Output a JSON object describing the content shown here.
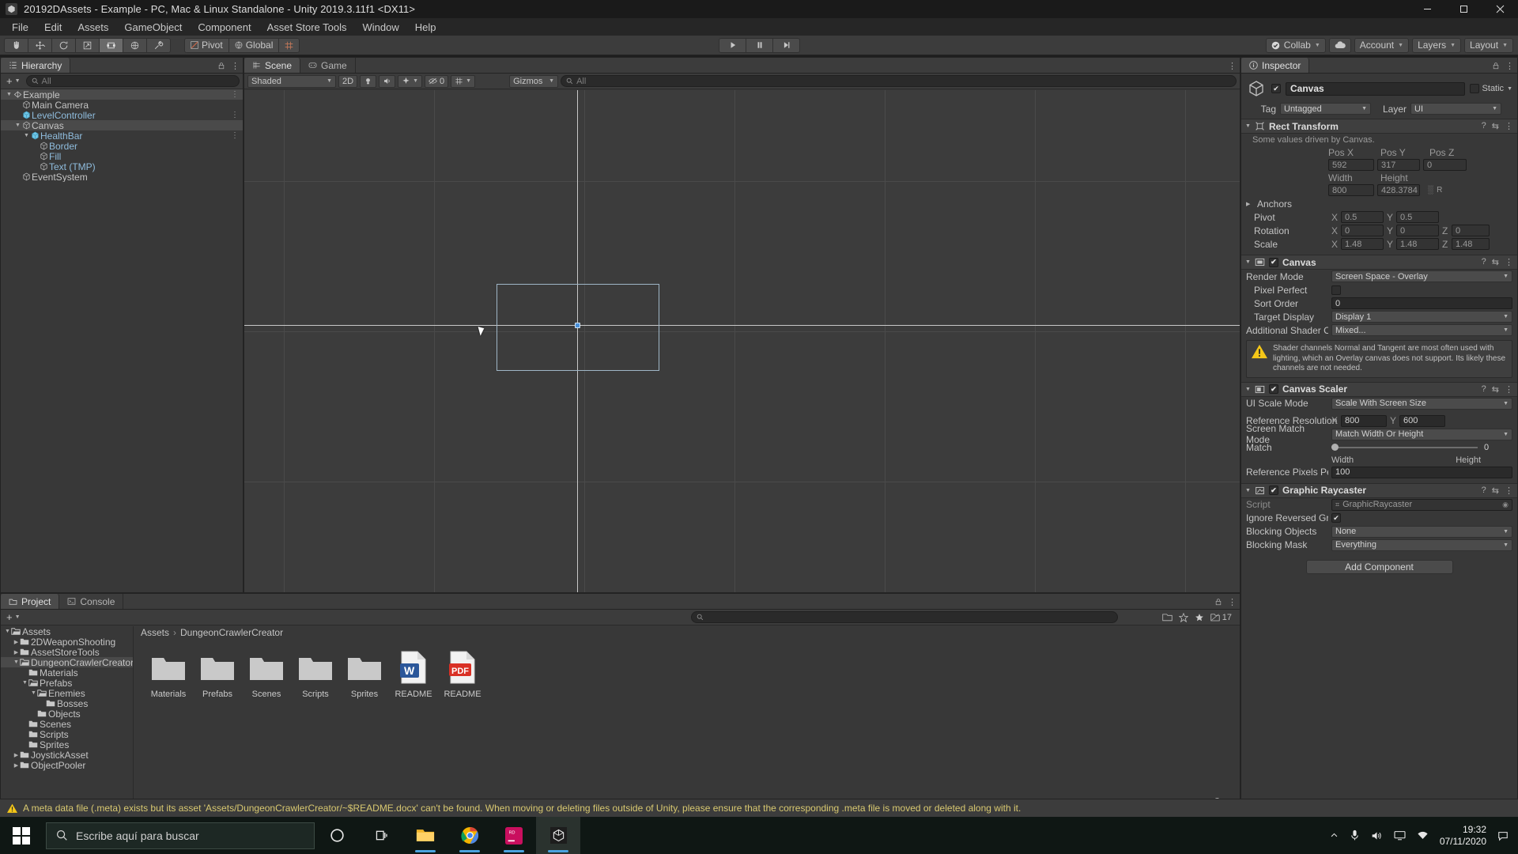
{
  "window": {
    "title": "20192DAssets - Example - PC, Mac & Linux Standalone - Unity 2019.3.11f1 <DX11>",
    "minimize": "–",
    "maximize": "☐",
    "close": "✕",
    "app_icon": "unity-icon"
  },
  "menubar": [
    "File",
    "Edit",
    "Assets",
    "GameObject",
    "Component",
    "Asset Store Tools",
    "Window",
    "Help"
  ],
  "toolbar": {
    "tools": [
      {
        "name": "hand-tool",
        "glyph": "✋",
        "selected": false
      },
      {
        "name": "move-tool",
        "glyph": "✥",
        "selected": false
      },
      {
        "name": "rotate-tool",
        "glyph": "↺",
        "selected": false
      },
      {
        "name": "scale-tool",
        "glyph": "↗",
        "selected": false
      },
      {
        "name": "rect-tool",
        "glyph": "⬚",
        "selected": true
      },
      {
        "name": "transform-tool",
        "glyph": "♁",
        "selected": false
      },
      {
        "name": "custom-tool",
        "glyph": "⚒",
        "selected": false
      }
    ],
    "pivot_label": "Pivot",
    "global_label": "Global",
    "grid_label": "grid-snap-icon",
    "play": "▶",
    "pause": "⏸",
    "step": "⏭",
    "collab_label": "Collab",
    "cloud_label": "cloud-icon",
    "account_label": "Account",
    "layers_label": "Layers",
    "layout_label": "Layout"
  },
  "hierarchy": {
    "tab_label": "Hierarchy",
    "create_label": "+",
    "search_placeholder": "All",
    "items": [
      {
        "label": "Example",
        "depth": 0,
        "icon": "scene-icon",
        "expanded": true,
        "selected": true,
        "prefab": false,
        "menu": true
      },
      {
        "label": "Main Camera",
        "depth": 1,
        "icon": "gameobject-icon",
        "expanded": null,
        "selected": false,
        "prefab": false
      },
      {
        "label": "LevelController",
        "depth": 1,
        "icon": "prefab-icon",
        "expanded": null,
        "selected": false,
        "prefab": true,
        "menu": true
      },
      {
        "label": "Canvas",
        "depth": 1,
        "icon": "gameobject-icon",
        "expanded": true,
        "selected": true,
        "prefab": false
      },
      {
        "label": "HealthBar",
        "depth": 2,
        "icon": "prefab-icon",
        "expanded": true,
        "selected": false,
        "prefab": true,
        "menu": true
      },
      {
        "label": "Border",
        "depth": 3,
        "icon": "gameobject-icon",
        "expanded": null,
        "selected": false,
        "prefab": true
      },
      {
        "label": "Fill",
        "depth": 3,
        "icon": "gameobject-icon",
        "expanded": null,
        "selected": false,
        "prefab": true
      },
      {
        "label": "Text (TMP)",
        "depth": 3,
        "icon": "gameobject-icon",
        "expanded": null,
        "selected": false,
        "prefab": true
      },
      {
        "label": "EventSystem",
        "depth": 1,
        "icon": "gameobject-icon",
        "expanded": null,
        "selected": false,
        "prefab": false
      }
    ]
  },
  "scene": {
    "tab_scene": "Scene",
    "tab_game": "Game",
    "shading_mode": "Shaded",
    "mode_2d": "2D",
    "lighting_icon": "lighting-icon",
    "audio_icon": "audio-icon",
    "fx_icon": "effects-icon",
    "hidden_count": "0",
    "grid_icon": "scene-grid-icon",
    "gizmos_label": "Gizmos",
    "search_placeholder": "All"
  },
  "inspector": {
    "tab_label": "Inspector",
    "object_name": "Canvas",
    "enabled": true,
    "static_label": "Static",
    "tag_label": "Tag",
    "tag_value": "Untagged",
    "layer_label": "Layer",
    "layer_value": "UI",
    "components": [
      {
        "title": "Rect Transform",
        "icon": "rect-transform-icon",
        "has_checkbox": false,
        "note": "Some values driven by Canvas.",
        "fields": {
          "pos_x_label": "Pos X",
          "pos_x": "592",
          "pos_y_label": "Pos Y",
          "pos_y": "317",
          "pos_z_label": "Pos Z",
          "pos_z": "0",
          "width_label": "Width",
          "width": "800",
          "height_label": "Height",
          "height": "428.3784",
          "anchors_label": "Anchors",
          "pivot_label": "Pivot",
          "pivot_x": "0.5",
          "pivot_y": "0.5",
          "rotation_label": "Rotation",
          "rot_x": "0",
          "rot_y": "0",
          "rot_z": "0",
          "scale_label": "Scale",
          "scale_x": "1.48",
          "scale_y": "1.48",
          "scale_z": "1.48"
        }
      },
      {
        "title": "Canvas",
        "icon": "canvas-icon",
        "has_checkbox": true,
        "rows": [
          {
            "label": "Render Mode",
            "type": "dropdown",
            "value": "Screen Space - Overlay"
          },
          {
            "label": "Pixel Perfect",
            "type": "checkbox",
            "value": false
          },
          {
            "label": "Sort Order",
            "type": "text",
            "value": "0"
          },
          {
            "label": "Target Display",
            "type": "dropdown",
            "value": "Display 1"
          },
          {
            "label": "Additional Shader Cha",
            "type": "dropdown",
            "value": "Mixed..."
          }
        ],
        "warning": "Shader channels Normal and Tangent are most often used with lighting, which an Overlay canvas does not support. Its likely these channels are not needed."
      },
      {
        "title": "Canvas Scaler",
        "icon": "canvas-scaler-icon",
        "has_checkbox": true,
        "rows": [
          {
            "label": "UI Scale Mode",
            "type": "dropdown",
            "value": "Scale With Screen Size"
          },
          {
            "label": "Reference Resolution",
            "type": "xy",
            "x": "800",
            "y": "600"
          },
          {
            "label": "Screen Match Mode",
            "type": "dropdown",
            "value": "Match Width Or Height"
          },
          {
            "label": "Match",
            "type": "slider",
            "value": "0",
            "left": "Width",
            "right": "Height"
          },
          {
            "label": "Reference Pixels Per I",
            "type": "text",
            "value": "100"
          }
        ]
      },
      {
        "title": "Graphic Raycaster",
        "icon": "graphic-raycaster-icon",
        "has_checkbox": true,
        "rows": [
          {
            "label": "Script",
            "type": "object",
            "value": "GraphicRaycaster"
          },
          {
            "label": "Ignore Reversed Grap",
            "type": "checkbox",
            "value": true
          },
          {
            "label": "Blocking Objects",
            "type": "dropdown",
            "value": "None"
          },
          {
            "label": "Blocking Mask",
            "type": "dropdown",
            "value": "Everything"
          }
        ]
      }
    ],
    "add_component_label": "Add Component"
  },
  "project": {
    "tab_project": "Project",
    "tab_console": "Console",
    "create_label": "+",
    "search_placeholder": "",
    "asset_count": "17",
    "breadcrumb": [
      "Assets",
      "DungeonCrawlerCreator"
    ],
    "tree": [
      {
        "label": "Assets",
        "depth": 0,
        "expanded": true,
        "selected": false,
        "open": true
      },
      {
        "label": "2DWeaponShooting",
        "depth": 1,
        "expanded": false,
        "selected": false,
        "open": false
      },
      {
        "label": "AssetStoreTools",
        "depth": 1,
        "expanded": false,
        "selected": false,
        "open": false
      },
      {
        "label": "DungeonCrawlerCreator",
        "depth": 1,
        "expanded": true,
        "selected": true,
        "open": true
      },
      {
        "label": "Materials",
        "depth": 2,
        "expanded": null,
        "selected": false,
        "open": false
      },
      {
        "label": "Prefabs",
        "depth": 2,
        "expanded": true,
        "selected": false,
        "open": true
      },
      {
        "label": "Enemies",
        "depth": 3,
        "expanded": true,
        "selected": false,
        "open": true
      },
      {
        "label": "Bosses",
        "depth": 4,
        "expanded": null,
        "selected": false,
        "open": false
      },
      {
        "label": "Objects",
        "depth": 3,
        "expanded": null,
        "selected": false,
        "open": false
      },
      {
        "label": "Scenes",
        "depth": 2,
        "expanded": null,
        "selected": false,
        "open": false
      },
      {
        "label": "Scripts",
        "depth": 2,
        "expanded": null,
        "selected": false,
        "open": false
      },
      {
        "label": "Sprites",
        "depth": 2,
        "expanded": null,
        "selected": false,
        "open": false
      },
      {
        "label": "JoystickAsset",
        "depth": 1,
        "expanded": false,
        "selected": false,
        "open": false
      },
      {
        "label": "ObjectPooler",
        "depth": 1,
        "expanded": false,
        "selected": false,
        "open": false
      }
    ],
    "assets": [
      {
        "name": "Materials",
        "type": "folder"
      },
      {
        "name": "Prefabs",
        "type": "folder"
      },
      {
        "name": "Scenes",
        "type": "folder"
      },
      {
        "name": "Scripts",
        "type": "folder"
      },
      {
        "name": "Sprites",
        "type": "folder"
      },
      {
        "name": "README",
        "type": "docx"
      },
      {
        "name": "README",
        "type": "pdf"
      }
    ]
  },
  "status": {
    "icon": "warning-icon",
    "message": "A meta data file (.meta) exists but its asset 'Assets/DungeonCrawlerCreator/~$README.docx' can't be found. When moving or deleting files outside of Unity, please ensure that the corresponding .meta file is moved or deleted along with it."
  },
  "taskbar": {
    "start_icon": "windows-start-icon",
    "search_placeholder": "Escribe aquí para buscar",
    "items": [
      {
        "name": "cortana-icon",
        "glyph": "○",
        "active": false,
        "running": false
      },
      {
        "name": "task-view-icon",
        "glyph": "⌸",
        "active": false,
        "running": false
      },
      {
        "name": "file-explorer-icon",
        "glyph": "folder",
        "active": false,
        "running": true
      },
      {
        "name": "chrome-icon",
        "glyph": "chrome",
        "active": false,
        "running": true
      },
      {
        "name": "rider-icon",
        "glyph": "RD",
        "active": false,
        "running": true
      },
      {
        "name": "unity-icon",
        "glyph": "unity",
        "active": true,
        "running": true
      }
    ],
    "tray": [
      "▲",
      "🎤",
      "🔊",
      "💻",
      "🌐"
    ],
    "time": "19:32",
    "date": "07/11/2020"
  },
  "colors": {
    "accent": "#4a90d9",
    "panel_bg": "#383838",
    "toolbar_bg": "#3c3c3c",
    "warning": "#d8c870",
    "prefab_blue": "#8fbcdd"
  }
}
